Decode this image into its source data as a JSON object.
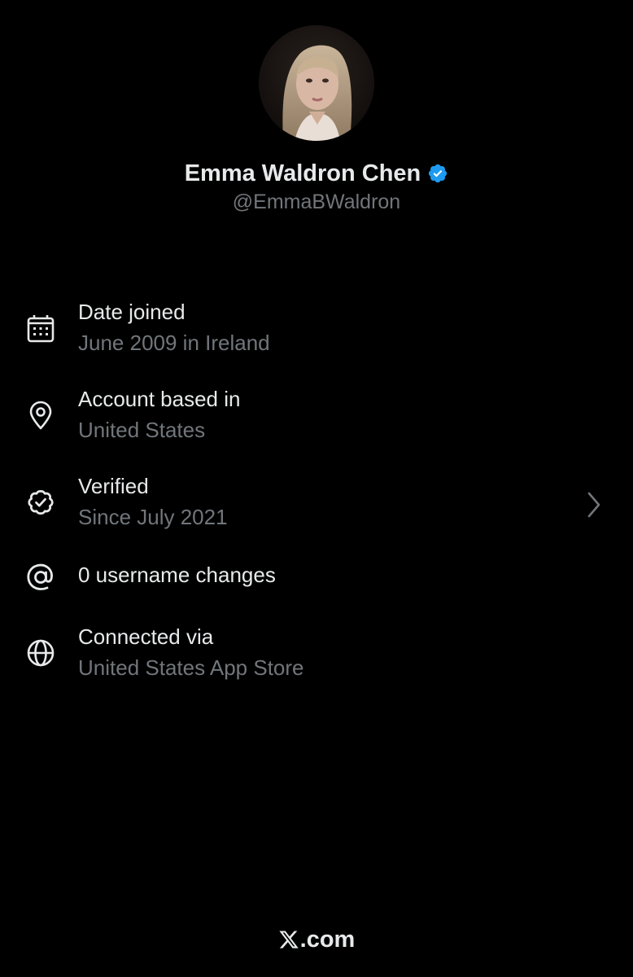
{
  "profile": {
    "display_name": "Emma Waldron Chen",
    "handle": "@EmmaBWaldron",
    "verified": true,
    "badge_color": "#1d9bf0"
  },
  "about": {
    "items": [
      {
        "icon": "calendar-icon",
        "title": "Date joined",
        "subtitle": "June 2009 in Ireland"
      },
      {
        "icon": "location-pin-icon",
        "title": "Account based in",
        "subtitle": "United States"
      },
      {
        "icon": "verified-check-icon",
        "title": "Verified",
        "subtitle": "Since July 2021",
        "has_chevron": true
      },
      {
        "icon": "at-sign-icon",
        "title": "0 username changes"
      },
      {
        "icon": "globe-icon",
        "title": "Connected via",
        "subtitle": "United States App Store"
      }
    ]
  },
  "footer": {
    "logo": "x-logo",
    "domain": ".com"
  },
  "colors": {
    "background": "#000000",
    "primary_text": "#e7e9ea",
    "secondary_text": "#71767b",
    "accent": "#1d9bf0"
  }
}
